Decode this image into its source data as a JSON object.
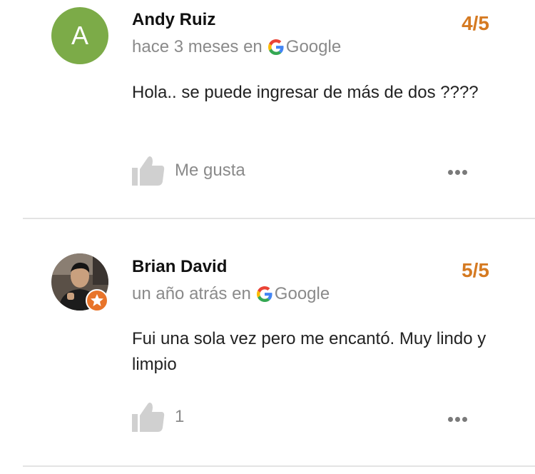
{
  "reviews": [
    {
      "author": "Andy Ruiz",
      "avatar_letter": "A",
      "time": "hace 3 meses en",
      "source": "Google",
      "rating": "4/5",
      "text": "Hola.. se puede ingresar de más de dos ????",
      "like_label": "Me gusta"
    },
    {
      "author": "Brian David",
      "time": "un año atrás en",
      "source": "Google",
      "rating": "5/5",
      "text": "Fui una sola vez pero me encantó. Muy lindo y limpio",
      "like_label": "1"
    }
  ],
  "colors": {
    "rating": "#d57a22",
    "avatar_green": "#7cab48",
    "badge_orange": "#e8742a",
    "muted_text": "#8a8a8a"
  },
  "icons": [
    "google-icon",
    "thumbs-up-icon",
    "more-options-icon",
    "local-guide-badge-icon"
  ]
}
